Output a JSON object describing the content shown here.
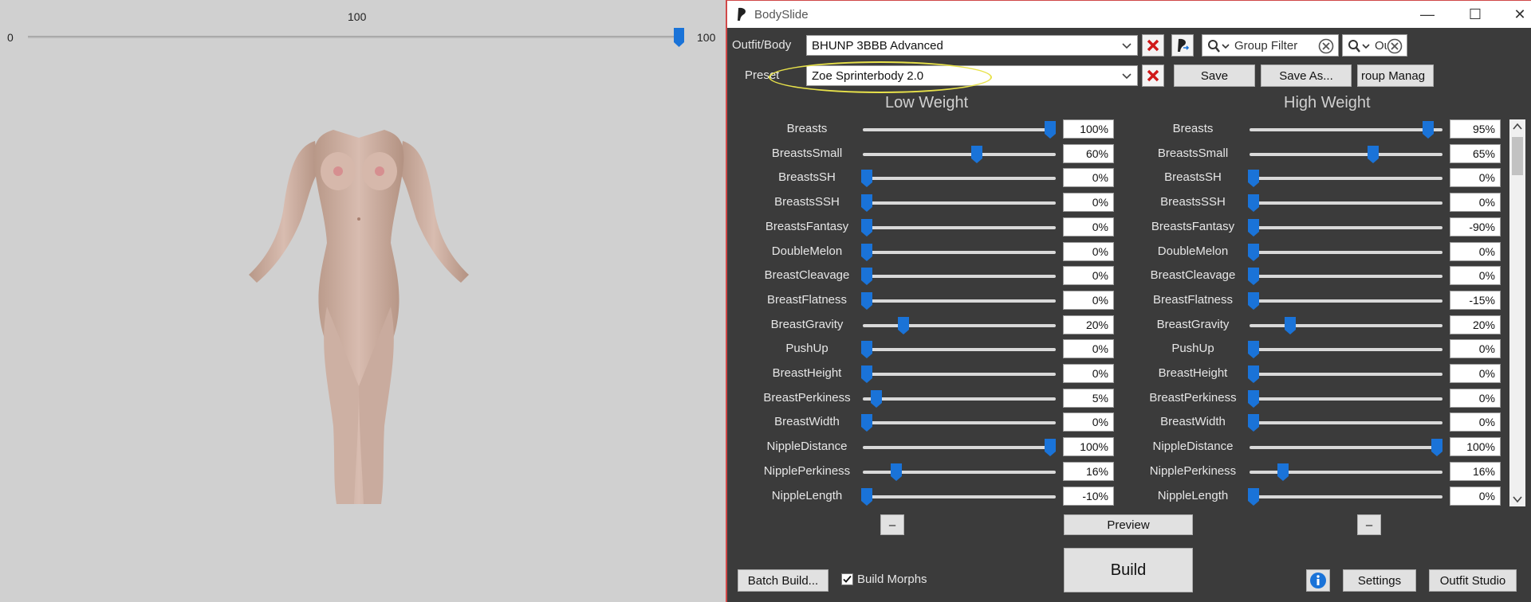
{
  "preview": {
    "weight_value": "100",
    "weight_min": "0",
    "weight_max": "100",
    "weight_fraction": 1.0
  },
  "window": {
    "title": "BodySlide",
    "minimize_glyph": "—",
    "maximize_glyph": "☐",
    "close_glyph": "✕"
  },
  "outfit": {
    "label": "Outfit/Body",
    "value": "BHUNP 3BBB Advanced"
  },
  "preset": {
    "label": "Preset",
    "value": "Zoe Sprinterbody 2.0"
  },
  "filters": {
    "group_filter_placeholder": "Group Filter",
    "outfit_filter_text": "Outf"
  },
  "buttons": {
    "save": "Save",
    "save_as": "Save As...",
    "group_manager": "roup Manag",
    "preview": "Preview",
    "build": "Build",
    "batch_build": "Batch Build...",
    "build_morphs": "Build Morphs",
    "settings": "Settings",
    "outfit_studio": "Outfit Studio",
    "collapse": "–"
  },
  "columns": {
    "low": "Low Weight",
    "high": "High Weight"
  },
  "accent_color": "#1a73d8",
  "sliders": [
    {
      "name": "Breasts",
      "low": 100,
      "low_text": "100%",
      "high": 95,
      "high_text": "95%"
    },
    {
      "name": "BreastsSmall",
      "low": 60,
      "low_text": "60%",
      "high": 65,
      "high_text": "65%"
    },
    {
      "name": "BreastsSH",
      "low": 0,
      "low_text": "0%",
      "high": 0,
      "high_text": "0%"
    },
    {
      "name": "BreastsSSH",
      "low": 0,
      "low_text": "0%",
      "high": 0,
      "high_text": "0%"
    },
    {
      "name": "BreastsFantasy",
      "low": 0,
      "low_text": "0%",
      "high": 0,
      "high_text": "-90%"
    },
    {
      "name": "DoubleMelon",
      "low": 0,
      "low_text": "0%",
      "high": 0,
      "high_text": "0%"
    },
    {
      "name": "BreastCleavage",
      "low": 0,
      "low_text": "0%",
      "high": 0,
      "high_text": "0%"
    },
    {
      "name": "BreastFlatness",
      "low": 0,
      "low_text": "0%",
      "high": 0,
      "high_text": "-15%"
    },
    {
      "name": "BreastGravity",
      "low": 20,
      "low_text": "20%",
      "high": 20,
      "high_text": "20%"
    },
    {
      "name": "PushUp",
      "low": 0,
      "low_text": "0%",
      "high": 0,
      "high_text": "0%"
    },
    {
      "name": "BreastHeight",
      "low": 0,
      "low_text": "0%",
      "high": 0,
      "high_text": "0%"
    },
    {
      "name": "BreastPerkiness",
      "low": 5,
      "low_text": "5%",
      "high": 0,
      "high_text": "0%"
    },
    {
      "name": "BreastWidth",
      "low": 0,
      "low_text": "0%",
      "high": 0,
      "high_text": "0%"
    },
    {
      "name": "NippleDistance",
      "low": 100,
      "low_text": "100%",
      "high": 100,
      "high_text": "100%"
    },
    {
      "name": "NipplePerkiness",
      "low": 16,
      "low_text": "16%",
      "high": 16,
      "high_text": "16%"
    },
    {
      "name": "NippleLength",
      "low": 0,
      "low_text": "-10%",
      "high": 0,
      "high_text": "0%"
    }
  ]
}
